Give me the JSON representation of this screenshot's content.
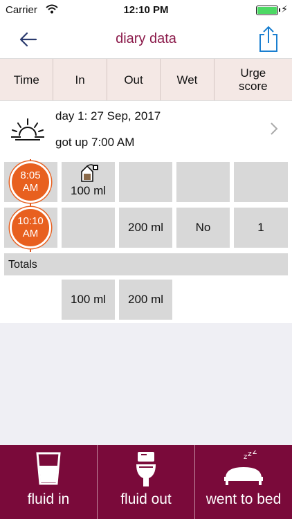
{
  "status": {
    "carrier": "Carrier",
    "time": "12:10 PM"
  },
  "nav": {
    "title": "diary data"
  },
  "headers": [
    "Time",
    "In",
    "Out",
    "Wet",
    "Urge score"
  ],
  "day": {
    "line1": "day 1: 27 Sep, 2017",
    "line2": "got up 7:00 AM"
  },
  "entries": [
    {
      "time": "8:05 AM",
      "in": "100 ml",
      "out": "",
      "wet": "",
      "urge": "",
      "in_icon": "tea-bag-icon"
    },
    {
      "time": "10:10 AM",
      "in": "",
      "out": "200 ml",
      "wet": "No",
      "urge": "1"
    }
  ],
  "totals": {
    "label": "Totals",
    "in": "100 ml",
    "out": "200 ml"
  },
  "actions": [
    {
      "label": "fluid in",
      "icon": "glass-icon"
    },
    {
      "label": "fluid out",
      "icon": "toilet-icon"
    },
    {
      "label": "went to bed",
      "icon": "bed-icon"
    }
  ],
  "colors": {
    "accent": "#7a0a3a",
    "badge": "#e8601f",
    "header_bg": "#f4e8e5"
  }
}
